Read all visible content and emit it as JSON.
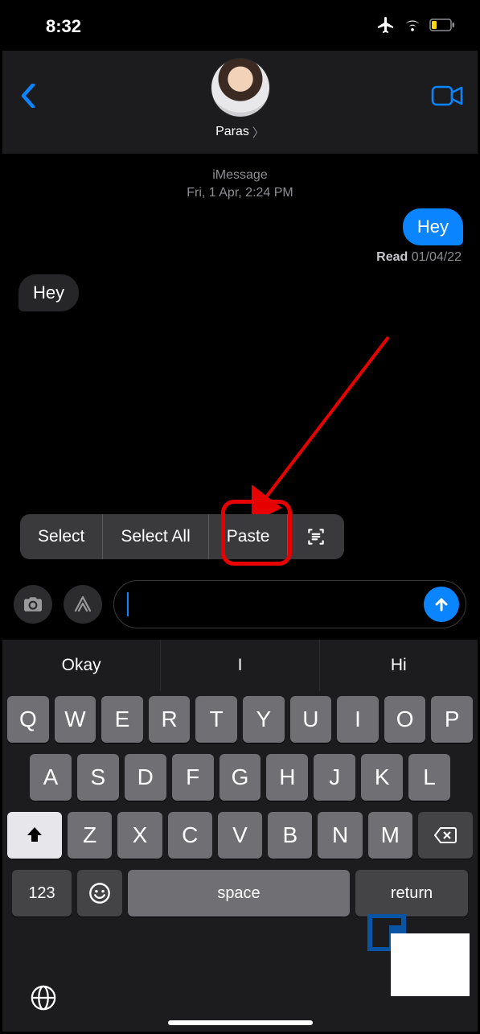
{
  "status": {
    "time": "8:32"
  },
  "header": {
    "contact_name": "Paras"
  },
  "thread": {
    "service": "iMessage",
    "timestamp": "Fri, 1 Apr, 2:24 PM",
    "outgoing_text": "Hey",
    "read_label": "Read",
    "read_date": "01/04/22",
    "incoming_text": "Hey"
  },
  "editmenu": {
    "select": "Select",
    "select_all": "Select All",
    "paste": "Paste"
  },
  "compose": {
    "placeholder": ""
  },
  "predictions": {
    "p1": "Okay",
    "p2": "I",
    "p3": "Hi"
  },
  "keyboard": {
    "row1": [
      "Q",
      "W",
      "E",
      "R",
      "T",
      "Y",
      "U",
      "I",
      "O",
      "P"
    ],
    "row2": [
      "A",
      "S",
      "D",
      "F",
      "G",
      "H",
      "J",
      "K",
      "L"
    ],
    "row3": [
      "Z",
      "X",
      "C",
      "V",
      "B",
      "N",
      "M"
    ],
    "k123": "123",
    "space": "space",
    "ret": "return"
  }
}
